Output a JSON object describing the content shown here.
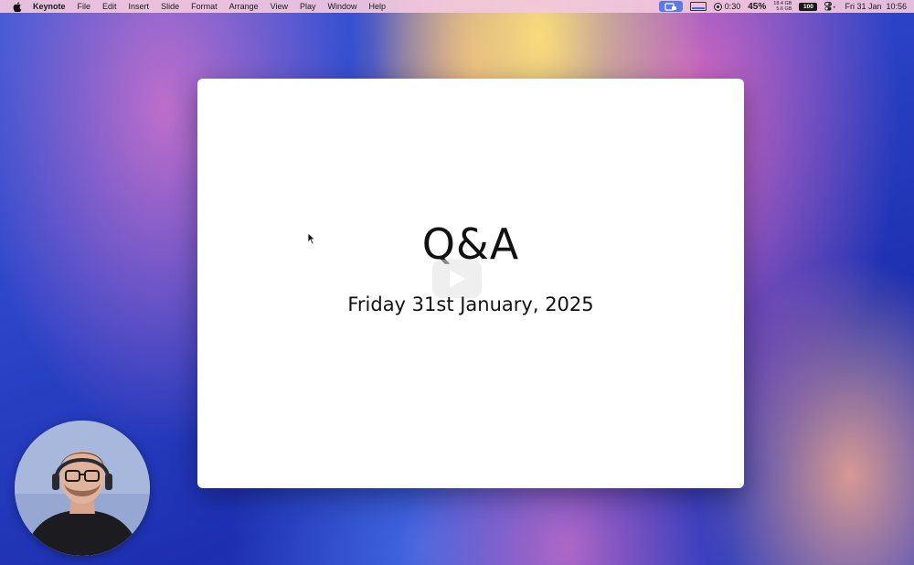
{
  "menubar": {
    "app_name": "Keynote",
    "items": [
      "File",
      "Edit",
      "Insert",
      "Slide",
      "Format",
      "Arrange",
      "View",
      "Play",
      "Window",
      "Help"
    ],
    "status": {
      "timer": "0:30",
      "cpu_percent": "45%",
      "memory_top": "18.4 GB",
      "memory_bottom": "5.6 GB",
      "battery": "100",
      "datetime": "Fri 31 Jan  10:56"
    }
  },
  "slide": {
    "title": "Q&A",
    "subtitle": "Friday 31st January, 2025"
  },
  "icons": {
    "apple": "apple-icon",
    "cast": "screen-share-icon",
    "display": "display-icon",
    "record": "record-icon",
    "play": "play-icon",
    "control_center": "control-center-icon",
    "cursor": "cursor-icon"
  },
  "colors": {
    "menubar_bg": "#f2c8de",
    "slide_bg": "#ffffff",
    "cast_accent": "#5a7ae6"
  }
}
